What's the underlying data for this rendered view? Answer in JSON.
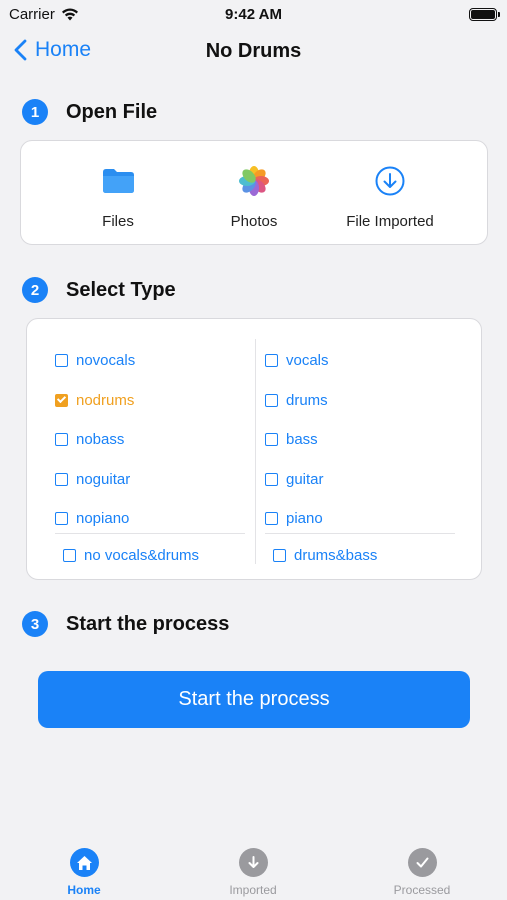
{
  "status_bar": {
    "carrier": "Carrier",
    "time": "9:42 AM"
  },
  "nav": {
    "back_label": "Home",
    "title": "No Drums"
  },
  "sections": {
    "open_file": {
      "number": "1",
      "title": "Open File"
    },
    "select_type": {
      "number": "2",
      "title": "Select Type"
    },
    "start": {
      "number": "3",
      "title": "Start the process"
    }
  },
  "file_options": [
    {
      "label": "Files",
      "icon": "folder-icon"
    },
    {
      "label": "Photos",
      "icon": "photos-icon"
    },
    {
      "label": "File Imported",
      "icon": "download-circle-icon"
    }
  ],
  "type_options": {
    "left": [
      {
        "label": "novocals",
        "checked": false
      },
      {
        "label": "nodrums",
        "checked": true
      },
      {
        "label": "nobass",
        "checked": false
      },
      {
        "label": "noguitar",
        "checked": false
      },
      {
        "label": "nopiano",
        "checked": false
      }
    ],
    "right": [
      {
        "label": "vocals",
        "checked": false
      },
      {
        "label": "drums",
        "checked": false
      },
      {
        "label": "bass",
        "checked": false
      },
      {
        "label": "guitar",
        "checked": false
      },
      {
        "label": "piano",
        "checked": false
      }
    ],
    "partial_left": "no vocals&drums",
    "partial_right": "drums&bass"
  },
  "start_button": {
    "label": "Start the process"
  },
  "tabs": [
    {
      "label": "Home",
      "icon": "home-icon",
      "active": true
    },
    {
      "label": "Imported",
      "icon": "download-icon",
      "active": false
    },
    {
      "label": "Processed",
      "icon": "checkmark-icon",
      "active": false
    }
  ],
  "colors": {
    "accent": "#1a82f7",
    "selected": "#f0a020",
    "inactive": "#9a9a9e",
    "background": "#f2f2f4"
  }
}
